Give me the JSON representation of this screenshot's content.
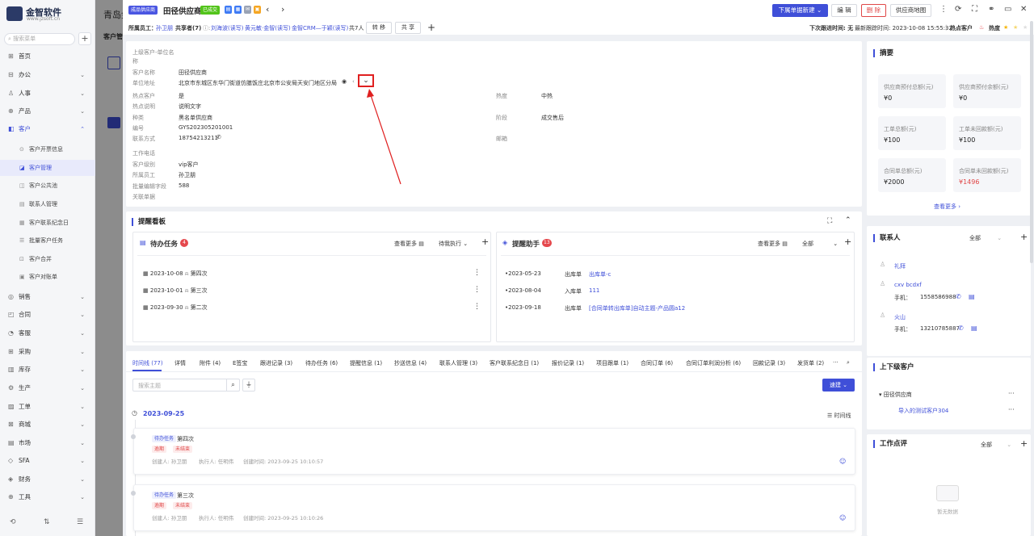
{
  "app": {
    "logo_name": "金智软件",
    "logo_url": "www.jzsoft.cn"
  },
  "sidebar": {
    "search_placeholder": "搜索菜单",
    "items": [
      {
        "label": "首页",
        "icon": "home-icon"
      },
      {
        "label": "办公",
        "icon": "office-icon"
      },
      {
        "label": "人事",
        "icon": "person-icon"
      },
      {
        "label": "产品",
        "icon": "product-icon"
      },
      {
        "label": "客户",
        "icon": "customer-icon"
      }
    ],
    "sub_items": [
      "客户开票信息",
      "客户管理",
      "客户公共池",
      "联系人管理",
      "客户联系纪念日",
      "批量客户任务",
      "客户合并",
      "客户对账单"
    ],
    "items_bottom": [
      "销售",
      "合同",
      "客服",
      "采购",
      "库存",
      "生产",
      "工单",
      "商城",
      "市场",
      "SFA",
      "财务",
      "工具"
    ]
  },
  "background": {
    "title": "青岛金",
    "subtitle": "客户管"
  },
  "header": {
    "type_tag": "成品供应商",
    "title": "田径供应商",
    "deal_tag": "已成交",
    "new_button": "下属单据新建",
    "edit_button": "编 辑",
    "delete_button": "删 除",
    "map_button": "供应商地图"
  },
  "subbar": {
    "owner_label": "所属员工：",
    "owner_value": "孙卫朋",
    "share_label": "共享者(7)",
    "share_value": "刘海波(读写)",
    "share_more": "黄元敏·金智(读写)",
    "share_more2": "金智CRM—于颖(读写)",
    "share_count": "共7人",
    "transfer_button": "转 移",
    "share_button": "共 享",
    "next_follow": "下次跟进时间: 无",
    "last_follow": "最新跟踪时间: 2023-10-08 15:55:32",
    "hot_label": "热点客户",
    "heat_label": "热度"
  },
  "info": {
    "parent_label": "上级客户-单位名",
    "parent_label2": "称",
    "name_label": "客户名称",
    "name_value": "田径供应商",
    "address_label": "单位地址",
    "address_value": "北京市东城区东华门街道仿膳饭庄北京市公安局天安门地区分局",
    "hot_label": "热点客户",
    "hot_value": "是",
    "hotdesc_label": "热点说明",
    "hotdesc_value": "说明文字",
    "kind_label": "种类",
    "kind_value": "黑名单供应商",
    "code_label": "编号",
    "code_value": "GYS202305201001",
    "contact_label": "联系方式",
    "contact_value": "18754213211",
    "workphone_label": "工作电话",
    "level_label": "客户级别",
    "level_value": "vip客户",
    "emp_label": "所属员工",
    "emp_value": "孙卫朋",
    "batch_label": "批量编辑字段",
    "batch_value": "588",
    "related_label": "关联单据",
    "heat_label": "热度",
    "heat_value": "中热",
    "stage_label": "阶段",
    "stage_value": "成交售后",
    "post_label": "邮箱"
  },
  "summary": {
    "title": "摘要",
    "cards": [
      {
        "label": "供应商预付总额(元)",
        "value": "¥0"
      },
      {
        "label": "供应商预付余额(元)",
        "value": "¥0"
      },
      {
        "label": "工单总额(元)",
        "value": "¥100"
      },
      {
        "label": "工单未回款额(元)",
        "value": "¥100"
      },
      {
        "label": "合同单总额(元)",
        "value": "¥2000"
      },
      {
        "label": "合同单未回款额(元)",
        "value": "¥1496"
      }
    ],
    "more": "查看更多"
  },
  "remind": {
    "title": "提醒看板",
    "todo_title": "待办任务",
    "todo_count": "4",
    "todo_more": "查看更多",
    "todo_filter": "待我执行",
    "todos": [
      {
        "date": "2023-10-08",
        "text": "第四次"
      },
      {
        "date": "2023-10-01",
        "text": "第三次"
      },
      {
        "date": "2023-09-30",
        "text": "第二次"
      }
    ],
    "assist_title": "提醒助手",
    "assist_count": "13",
    "assist_more": "查看更多",
    "assist_filter": "全部",
    "assists": [
      {
        "date": "2023-05-23",
        "type": "出库单",
        "link": "出库单-c"
      },
      {
        "date": "2023-08-04",
        "type": "入库单",
        "link": "111"
      },
      {
        "date": "2023-09-18",
        "type": "出库单",
        "link": "[合同单转出库单]自动主题-产品圆a12"
      }
    ]
  },
  "tabs": [
    "时间线 (77)",
    "详情",
    "附件 (4)",
    "E签宝",
    "跟进记录 (3)",
    "待办任务 (6)",
    "提醒信息 (1)",
    "抄送信息 (4)",
    "联系人管理 (3)",
    "客户联系纪念日 (1)",
    "报价记录 (1)",
    "项目跟单 (1)",
    "合同订单 (6)",
    "合同订单利润分析 (6)",
    "回款记录 (3)",
    "发货单 (2)"
  ],
  "timeline": {
    "search_placeholder": "搜索主题",
    "quick_button": "速建",
    "date": "2023-09-25",
    "view_label": "时间线",
    "entries": [
      {
        "type": "待办任务",
        "title": "第四次",
        "tag1": "逾期",
        "tag2": "未结束",
        "creator": "创建人: 孙卫朋",
        "executor": "执行人: 任明伟",
        "created": "创建时间: 2023-09-25 10:10:57"
      },
      {
        "type": "待办任务",
        "title": "第三次",
        "tag1": "逾期",
        "tag2": "未结束",
        "creator": "创建人: 孙卫朋",
        "executor": "执行人: 任明伟",
        "created": "创建时间: 2023-09-25 10:10:26"
      }
    ]
  },
  "contacts": {
    "title": "联系人",
    "filter": "全部",
    "list": [
      {
        "name": "礼拜"
      },
      {
        "name": "cxv bcdxf",
        "phone_label": "手机：",
        "phone": "1558586988"
      },
      {
        "name": "火山",
        "phone_label": "手机：",
        "phone": "13210785887"
      }
    ]
  },
  "levels": {
    "title": "上下级客户",
    "parent": "田径供应商",
    "child": "导入的测试客户304"
  },
  "comments": {
    "title": "工作点评",
    "filter": "全部",
    "empty": "暂无数据"
  },
  "colors": {
    "accent": "#3f4fd8",
    "danger": "#e04747",
    "success": "#52c41a"
  }
}
